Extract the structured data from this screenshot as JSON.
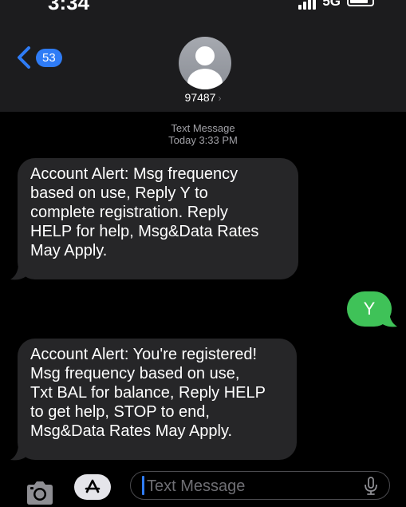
{
  "status_bar": {
    "time": "3:34",
    "network": "5G"
  },
  "header": {
    "back_badge": "53",
    "contact_name": "97487"
  },
  "thread": {
    "timestamp_label": "Text Message",
    "timestamp_time": "Today 3:33 PM",
    "messages": [
      {
        "direction": "incoming",
        "lines": [
          "Account Alert: Msg frequency",
          "based on use, Reply Y to",
          "complete registration. Reply",
          "HELP for help, Msg&Data Rates",
          "May Apply."
        ]
      },
      {
        "direction": "outgoing",
        "lines": [
          "Y"
        ]
      },
      {
        "direction": "incoming",
        "lines": [
          "Account Alert: You're registered!",
          "Msg frequency based on use,",
          "Txt BAL for balance, Reply HELP",
          "to get help, STOP to end,",
          "Msg&Data Rates May Apply."
        ]
      }
    ]
  },
  "input_bar": {
    "placeholder": "Text Message"
  },
  "colors": {
    "incoming_bubble": "#262628",
    "outgoing_bubble": "#3fc258",
    "accent_blue": "#2f7cf6",
    "header_bg": "#1c1c1e"
  }
}
